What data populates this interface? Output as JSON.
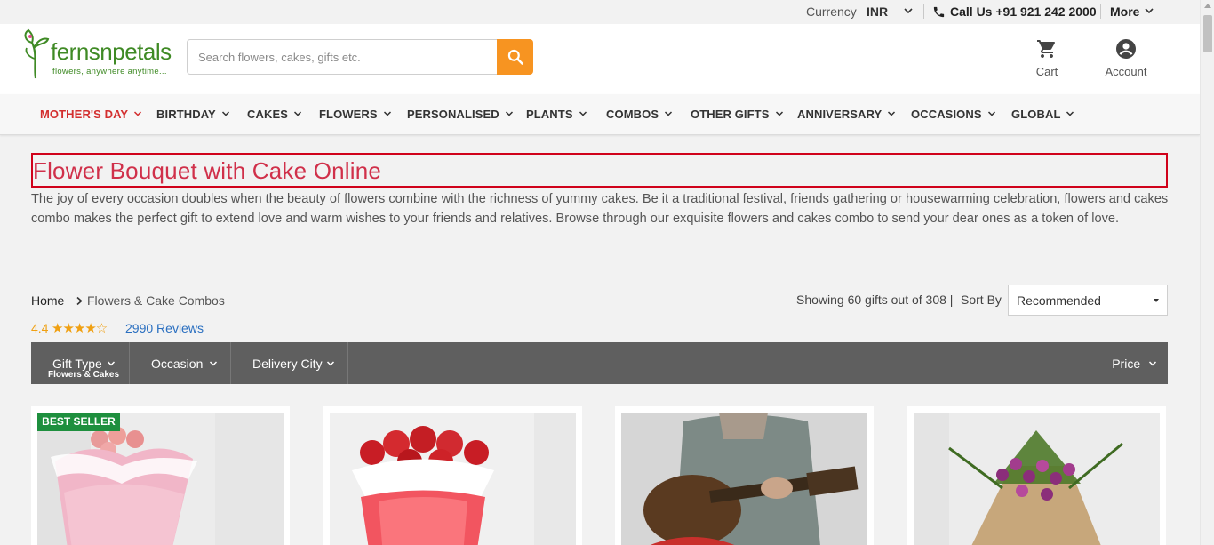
{
  "topbar": {
    "currency_label": "Currency",
    "currency_value": "INR",
    "call_label": "Call Us +91 921 242 2000",
    "more_label": "More"
  },
  "header": {
    "logo_name": "fernsnpetals",
    "logo_tagline": "flowers, anywhere anytime...",
    "search_placeholder": "Search flowers, cakes, gifts etc.",
    "cart_label": "Cart",
    "account_label": "Account",
    "brand_color": "#3f8a25",
    "search_button_color": "#f79421"
  },
  "nav": {
    "items": [
      {
        "label": "MOTHER'S DAY",
        "active": true
      },
      {
        "label": "BIRTHDAY"
      },
      {
        "label": "CAKES"
      },
      {
        "label": "FLOWERS"
      },
      {
        "label": "PERSONALISED"
      },
      {
        "label": "PLANTS"
      },
      {
        "label": "COMBOS"
      },
      {
        "label": "OTHER GIFTS"
      },
      {
        "label": "ANNIVERSARY"
      },
      {
        "label": "OCCASIONS"
      },
      {
        "label": "GLOBAL"
      }
    ]
  },
  "page": {
    "title": "Flower Bouquet with Cake Online",
    "description": "The joy of every occasion doubles when the beauty of flowers combine with the richness of yummy cakes. Be it a traditional festival, friends gathering or housewarming celebration, flowers and cakes combo makes the perfect gift to extend love and warm wishes to your friends and relatives. Browse through our exquisite flowers and cakes combo to send your dear ones as a token of love."
  },
  "breadcrumb": {
    "home": "Home",
    "current": "Flowers & Cake Combos"
  },
  "rating": {
    "value": "4.4",
    "stars": "★★★★☆",
    "reviews_count": "2990",
    "reviews_label": "Reviews"
  },
  "listing": {
    "showing_text": "Showing 60 gifts out of 308 |",
    "sort_label": "Sort By",
    "sort_value": "Recommended"
  },
  "filters": {
    "gift_type_label": "Gift Type",
    "gift_type_value": "Flowers & Cakes",
    "occasion_label": "Occasion",
    "delivery_city_label": "Delivery City",
    "price_label": "Price"
  },
  "products": [
    {
      "badge": "BEST SELLER",
      "image": "pink-roses-bouquet"
    },
    {
      "image": "red-carnations-bouquet"
    },
    {
      "image": "guitar-player-with-bouquet"
    },
    {
      "image": "purple-orchids-bouquet"
    }
  ],
  "colors": {
    "accent_red": "#d0021b",
    "nav_active": "#d32f2f",
    "filter_bar": "#5f5f5f",
    "badge_green": "#1e8f3e",
    "star_color": "#f0a012",
    "link_blue": "#2a6fc0"
  }
}
